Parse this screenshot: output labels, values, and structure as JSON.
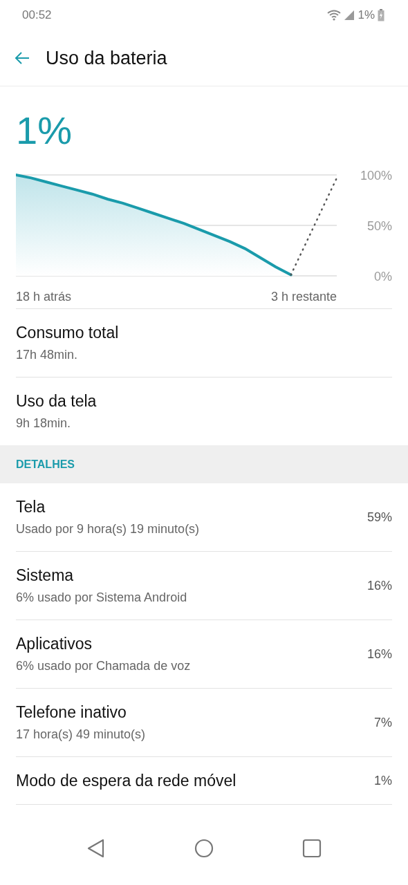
{
  "status_bar": {
    "time": "00:52",
    "battery_text": "1%"
  },
  "header": {
    "title": "Uso da bateria"
  },
  "battery_level_text": "1%",
  "chart_data": {
    "type": "area",
    "categories": [
      null,
      null,
      null,
      null,
      null,
      null,
      null,
      null,
      null,
      null,
      null,
      null,
      null,
      null,
      null,
      null,
      null,
      null,
      null,
      null,
      null,
      null
    ],
    "ylim": [
      0,
      100
    ],
    "yticks": [
      {
        "value": 0,
        "label": "0%"
      },
      {
        "value": 50,
        "label": "50%"
      },
      {
        "value": 100,
        "label": "100%"
      }
    ],
    "series": [
      {
        "color": "#1a9bab",
        "values": [
          100,
          97,
          93,
          89,
          85,
          81,
          76,
          72,
          67,
          62,
          57,
          52,
          46,
          40,
          34,
          27,
          18,
          9,
          1,
          null,
          null,
          null
        ]
      },
      {
        "color": "#555555",
        "type": "line",
        "line_style": "dotted",
        "values": [
          null,
          null,
          null,
          null,
          null,
          null,
          null,
          null,
          null,
          null,
          null,
          null,
          null,
          null,
          null,
          null,
          null,
          null,
          1,
          33,
          65,
          97
        ]
      }
    ]
  },
  "chart_range": {
    "start": "18 h atrás",
    "end": "3 h restante"
  },
  "summary": [
    {
      "title": "Consumo total",
      "value": "17h 48min."
    },
    {
      "title": "Uso da tela",
      "value": "9h 18min."
    }
  ],
  "details": {
    "heading": "DETALHES",
    "items": [
      {
        "title": "Tela",
        "subtitle": "Usado por 9 hora(s) 19 minuto(s)",
        "percent": "59%"
      },
      {
        "title": "Sistema",
        "subtitle": "6% usado por Sistema Android",
        "percent": "16%"
      },
      {
        "title": "Aplicativos",
        "subtitle": "6% usado por Chamada de voz",
        "percent": "16%"
      },
      {
        "title": "Telefone inativo",
        "subtitle": "17 hora(s) 49 minuto(s)",
        "percent": "7%"
      },
      {
        "title": "Modo de espera da rede móvel",
        "percent": "1%"
      }
    ]
  }
}
